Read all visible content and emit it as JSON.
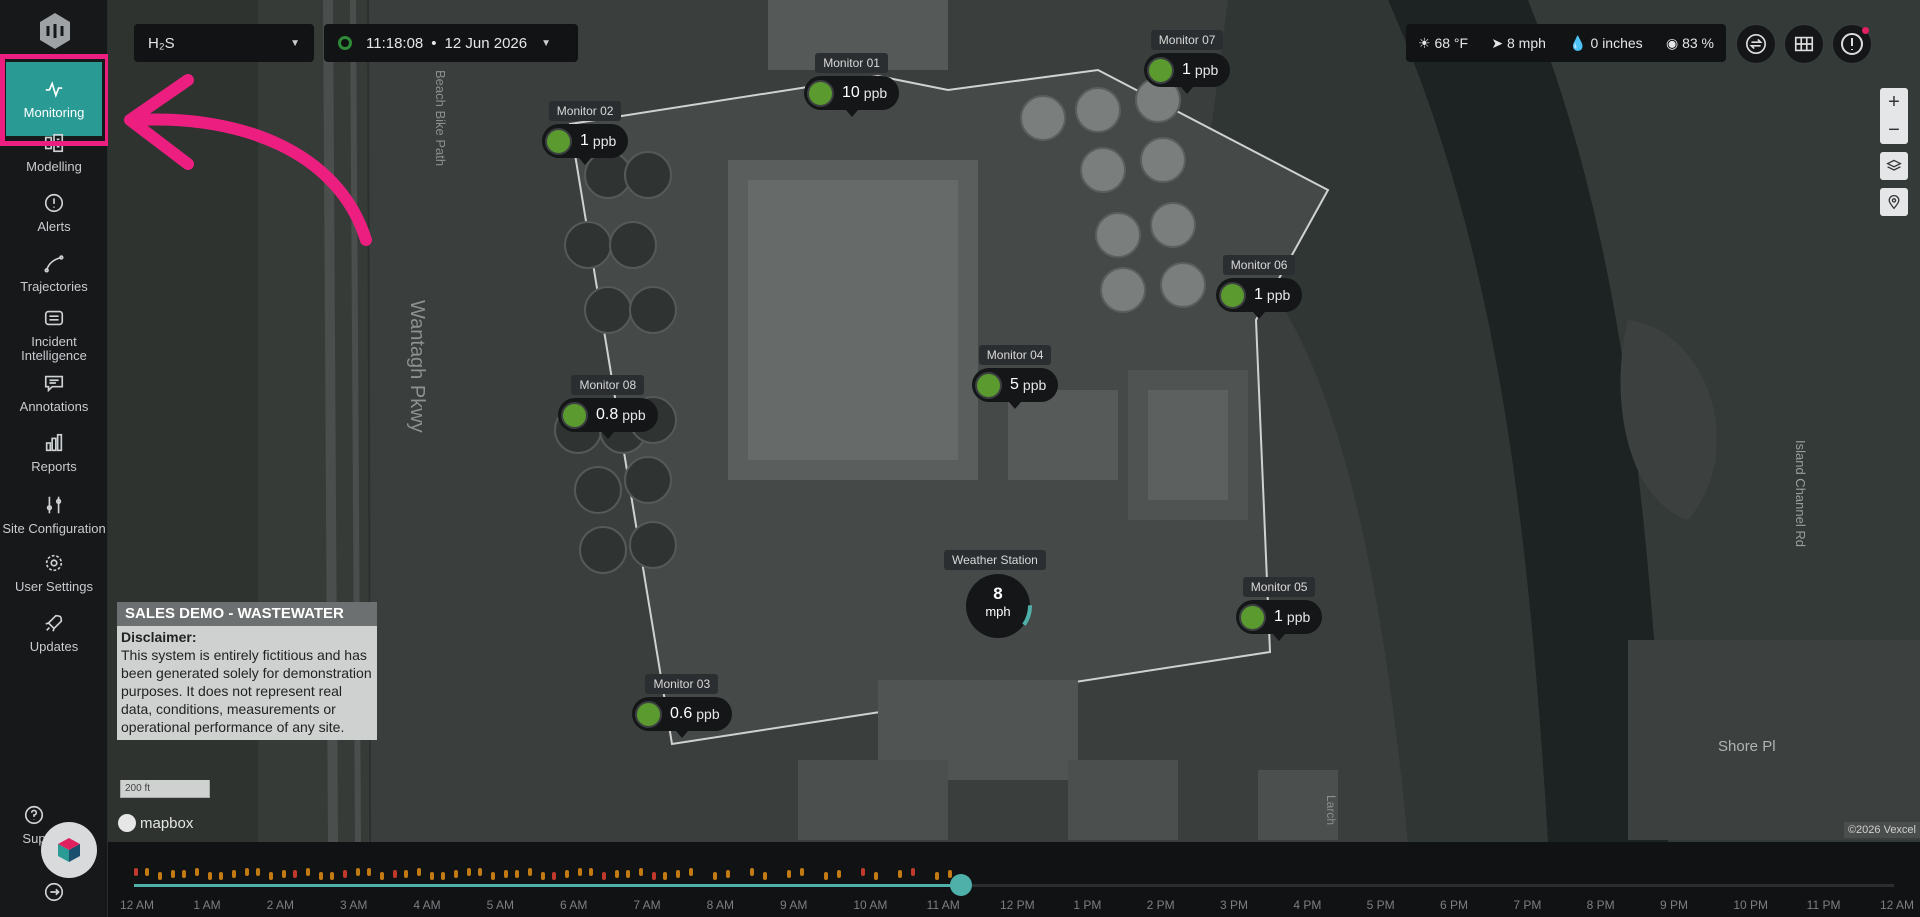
{
  "sidebar": {
    "items": [
      {
        "label": "Monitoring",
        "icon": "pulse-icon"
      },
      {
        "label": "Modelling",
        "icon": "modelling-icon"
      },
      {
        "label": "Alerts",
        "icon": "alert-circle-icon"
      },
      {
        "label": "Trajectories",
        "icon": "trajectory-icon"
      },
      {
        "label": "Incident Intelligence",
        "icon": "incident-icon"
      },
      {
        "label": "Annotations",
        "icon": "comment-icon"
      },
      {
        "label": "Reports",
        "icon": "bar-chart-icon"
      },
      {
        "label": "Site Configuration",
        "icon": "sliders-icon"
      },
      {
        "label": "User Settings",
        "icon": "gear-icon"
      },
      {
        "label": "Updates",
        "icon": "rocket-icon"
      },
      {
        "label": "Sup",
        "icon": "help-icon"
      },
      {
        "label": "",
        "icon": "logout-icon"
      }
    ]
  },
  "toolbar": {
    "gas_select": "H₂S",
    "time": "11:18:08",
    "separator": "•",
    "date": "12 Jun 2026"
  },
  "weather": {
    "temp": "68 °F",
    "wind": "8 mph",
    "rain": "0 inches",
    "humidity": "83 %"
  },
  "monitors": [
    {
      "name": "Monitor 01",
      "value": "10",
      "unit": "ppb"
    },
    {
      "name": "Monitor 02",
      "value": "1",
      "unit": "ppb"
    },
    {
      "name": "Monitor 03",
      "value": "0.6",
      "unit": "ppb"
    },
    {
      "name": "Monitor 04",
      "value": "5",
      "unit": "ppb"
    },
    {
      "name": "Monitor 05",
      "value": "1",
      "unit": "ppb"
    },
    {
      "name": "Monitor 06",
      "value": "1",
      "unit": "ppb"
    },
    {
      "name": "Monitor 07",
      "value": "1",
      "unit": "ppb"
    },
    {
      "name": "Monitor 08",
      "value": "0.8",
      "unit": "ppb"
    }
  ],
  "weather_station": {
    "name": "Weather Station",
    "value": "8",
    "unit": "mph"
  },
  "map_labels": {
    "road1": "Wantagh Pkwy",
    "road2": "Beach Bike Path",
    "road3": "Island Channel Rd",
    "road4": "Shore Pl",
    "road5": "Larch",
    "scale": "200 ft",
    "attribution": "©2026 Vexcel",
    "brand": "mapbox"
  },
  "disclaimer": {
    "title": "SALES DEMO - WASTEWATER",
    "head": "Disclaimer:",
    "body": "This system is entirely fictitious and has been generated solely for demonstration purposes. It does not represent real data, conditions, measurements or operational performance of any site."
  },
  "timeline": {
    "labels": [
      "12 AM",
      "1 AM",
      "2 AM",
      "3 AM",
      "4 AM",
      "5 AM",
      "6 AM",
      "7 AM",
      "8 AM",
      "9 AM",
      "10 AM",
      "11 AM",
      "12 PM",
      "1 PM",
      "2 PM",
      "3 PM",
      "4 PM",
      "5 PM",
      "6 PM",
      "7 PM",
      "8 PM",
      "9 PM",
      "10 PM",
      "11 PM",
      "12 AM"
    ],
    "progress": 0.47
  },
  "colors": {
    "accent": "#2a9a95",
    "highlight": "#ec1f80",
    "status_ok": "#5a9a2e"
  }
}
